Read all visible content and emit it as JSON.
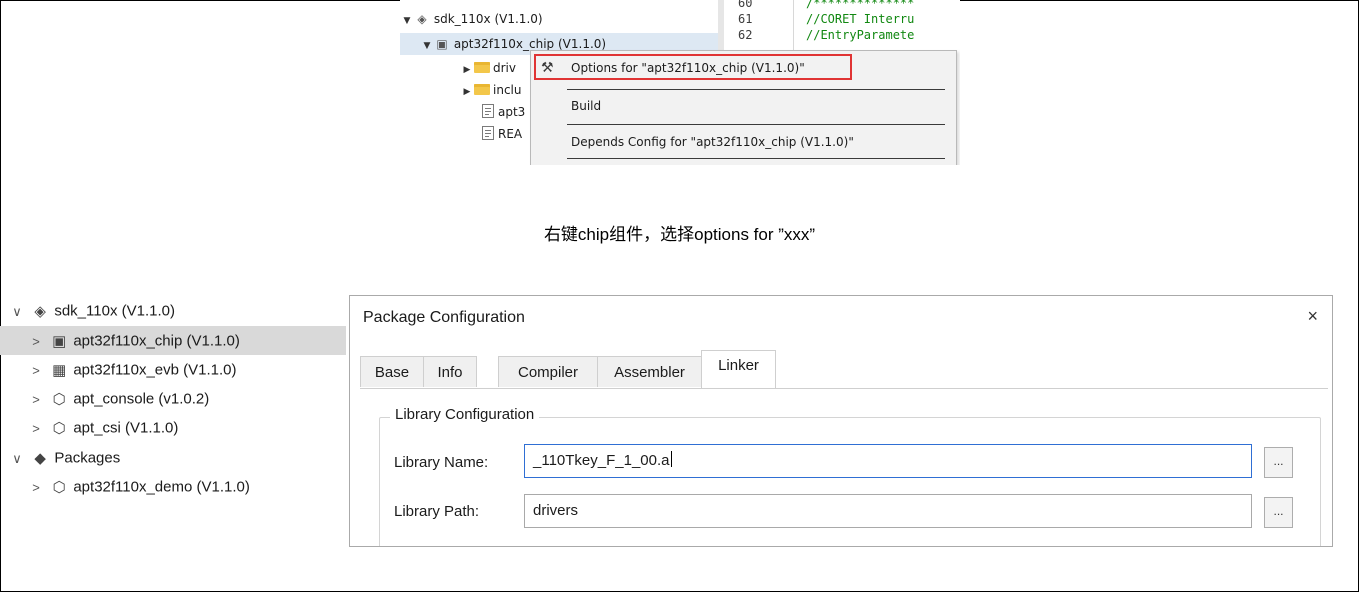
{
  "top_tree": {
    "rows": [
      {
        "label": "sdk_110x (V1.1.0)"
      },
      {
        "label": "apt32f110x_chip (V1.1.0)"
      },
      {
        "label": "driv"
      },
      {
        "label": "inclu"
      },
      {
        "label": "apt3"
      },
      {
        "label": "REA"
      }
    ]
  },
  "code": {
    "lines": [
      {
        "no": "60",
        "text": "/**************"
      },
      {
        "no": "61",
        "text": "//CORET Interru"
      },
      {
        "no": "62",
        "text": "//EntryParamete"
      }
    ]
  },
  "context_menu": {
    "options_label": "Options for \"apt32f110x_chip (V1.1.0)\"",
    "build_label": "Build",
    "depends_label": "Depends Config for \"apt32f110x_chip (V1.1.0)\"",
    "highlight_color": "#e03434"
  },
  "caption": "右键chip组件，选择options for ”xxx”",
  "bottom_tree": {
    "rows": [
      {
        "arrow": "∨",
        "label": "sdk_110x (V1.1.0)"
      },
      {
        "arrow": ">",
        "label": "apt32f110x_chip (V1.1.0)"
      },
      {
        "arrow": ">",
        "label": "apt32f110x_evb (V1.1.0)"
      },
      {
        "arrow": ">",
        "label": "apt_console (v1.0.2)"
      },
      {
        "arrow": ">",
        "label": "apt_csi (V1.1.0)"
      },
      {
        "arrow": "∨",
        "label": "Packages"
      },
      {
        "arrow": ">",
        "label": "apt32f110x_demo (V1.1.0)"
      }
    ]
  },
  "dialog": {
    "title": "Package Configuration",
    "close": "×",
    "tabs": [
      {
        "label": "Base"
      },
      {
        "label": "Info"
      },
      {
        "label": "Compiler"
      },
      {
        "label": "Assembler"
      },
      {
        "label": "Linker"
      }
    ],
    "active_tab": "Linker",
    "group_title": "Library Configuration",
    "library_name_label": "Library Name:",
    "library_name_value": "_110Tkey_F_1_00.a",
    "library_path_label": "Library Path:",
    "library_path_value": "drivers",
    "browse_label": "..."
  }
}
